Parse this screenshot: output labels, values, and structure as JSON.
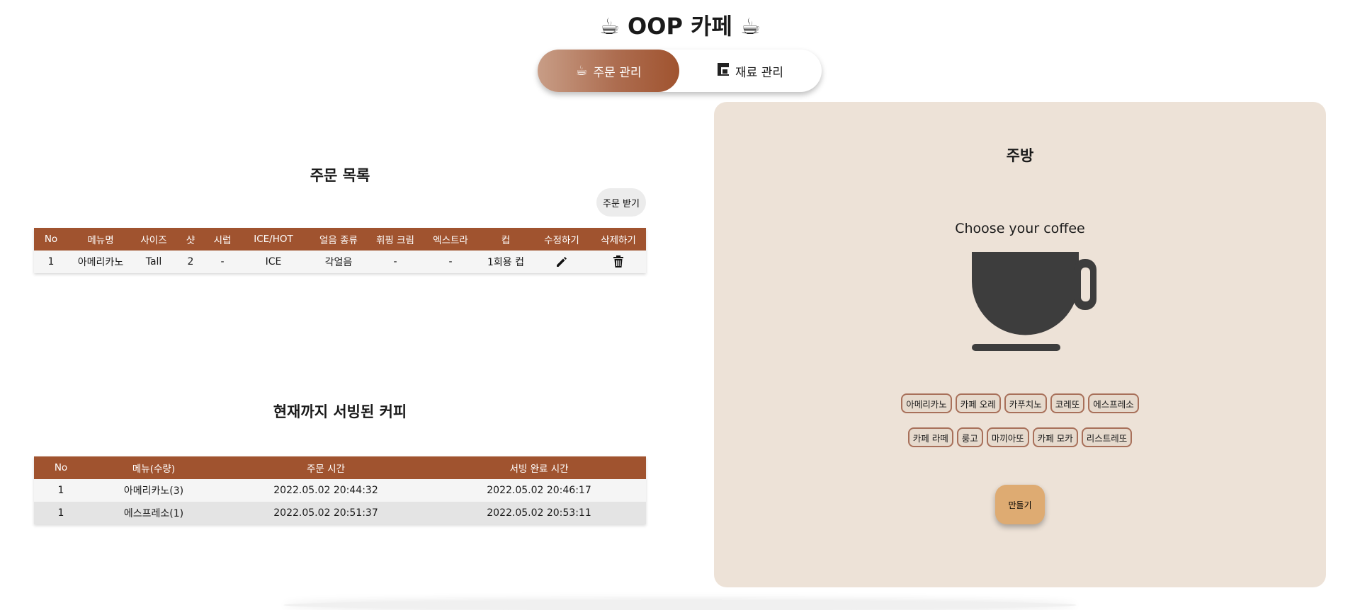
{
  "header": {
    "title": "☕ OOP 카페 ☕"
  },
  "tabs": [
    {
      "icon": "coffee-cup-icon",
      "label": "주문 관리",
      "active": true
    },
    {
      "icon": "coffee-machine-icon",
      "label": "재료 관리",
      "active": false
    }
  ],
  "orders": {
    "title": "주문 목록",
    "take_order_label": "주문 받기",
    "columns": [
      "No",
      "메뉴명",
      "사이즈",
      "샷",
      "시럽",
      "ICE/HOT",
      "얼음 종류",
      "휘핑 크림",
      "엑스트라",
      "컵",
      "수정하기",
      "삭제하기"
    ],
    "rows": [
      {
        "no": "1",
        "menu": "아메리카노",
        "size": "Tall",
        "shot": "2",
        "syrup": "-",
        "ice_hot": "ICE",
        "ice_type": "각얼음",
        "whip": "-",
        "extra": "-",
        "cup": "1회용 컵",
        "edit_icon": "pencil-icon",
        "delete_icon": "trash-icon"
      }
    ]
  },
  "served": {
    "title": "현재까지 서빙된 커피",
    "columns": [
      "No",
      "메뉴(수량)",
      "주문 시간",
      "서빙 완료 시간"
    ],
    "rows": [
      {
        "no": "1",
        "menu": "아메리카노(3)",
        "order_time": "2022.05.02 20:44:32",
        "serve_time": "2022.05.02 20:46:17"
      },
      {
        "no": "1",
        "menu": "에스프레소(1)",
        "order_time": "2022.05.02 20:51:37",
        "serve_time": "2022.05.02 20:53:11"
      }
    ]
  },
  "kitchen": {
    "title": "주방",
    "prompt": "Choose your coffee",
    "menu_row1": [
      "아메리카노",
      "카페 오레",
      "카푸치노",
      "코레또",
      "에스프레소"
    ],
    "menu_row2": [
      "카페 라떼",
      "룽고",
      "마끼아또",
      "카페 모카",
      "리스트레또"
    ],
    "make_label": "만들기"
  },
  "colors": {
    "accent": "#a0532f",
    "kitchen_bg": "#ede2d7",
    "make_button": "#deab72",
    "cup": "#3d3d3d"
  }
}
